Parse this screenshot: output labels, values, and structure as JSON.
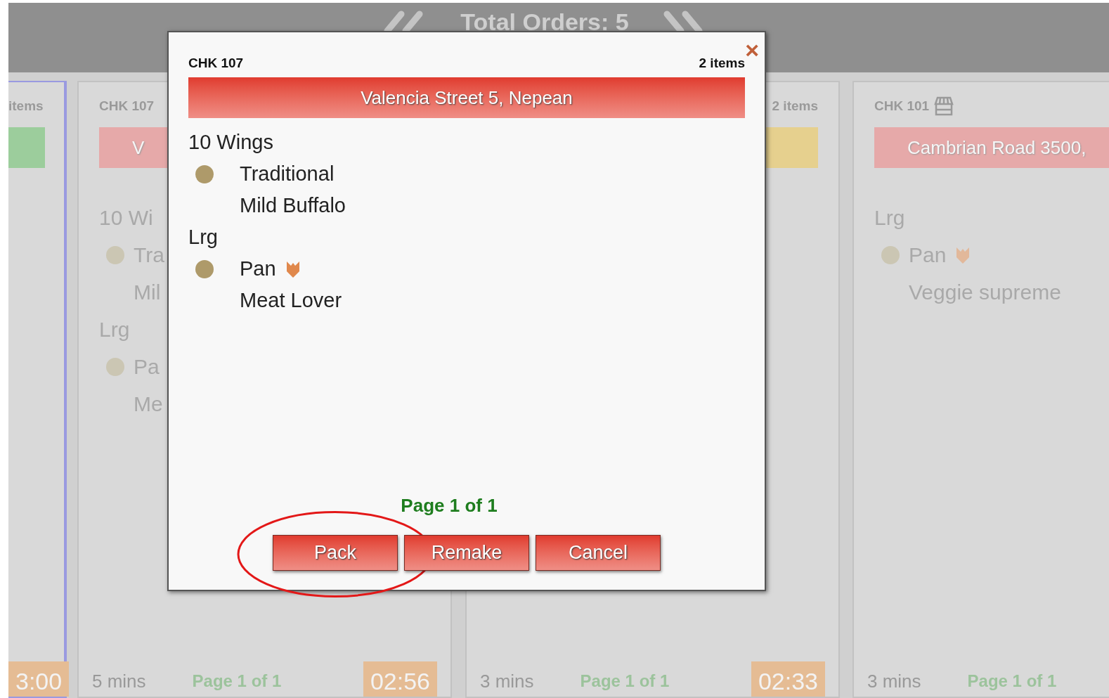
{
  "header": {
    "title": "Total Orders: 5"
  },
  "cards": [
    {
      "selected": true,
      "count": "items",
      "color": "#9ccd9c",
      "footer": {
        "timer": "3:00"
      }
    },
    {
      "selected": false,
      "check": "CHK 107",
      "address": "V",
      "color": "#e6a9a9",
      "lines": [
        {
          "kind": "group",
          "text": "10 Wi"
        },
        {
          "kind": "item",
          "text": "Tra"
        },
        {
          "kind": "sub",
          "text": "Mil"
        },
        {
          "kind": "group",
          "text": "Lrg"
        },
        {
          "kind": "item",
          "text": "Pa"
        },
        {
          "kind": "sub",
          "text": "Me"
        }
      ],
      "footer": {
        "duration": "5 mins",
        "page": "Page 1 of 1",
        "timer": "02:56"
      }
    },
    {
      "selected": false,
      "count": "2 items",
      "color": "#e6d08e",
      "footer": {
        "duration": "3 mins",
        "page": "Page 1 of 1",
        "timer": "02:33"
      }
    },
    {
      "selected": false,
      "check": "CHK 101",
      "store": true,
      "address": "Cambrian Road 3500,",
      "color": "#e6a9a9",
      "lines": [
        {
          "kind": "group",
          "text": "Lrg",
          "marked": false
        },
        {
          "kind": "item",
          "text": "Pan",
          "marked": true
        },
        {
          "kind": "sub",
          "text": "Veggie supreme",
          "marked": false
        }
      ],
      "footer": {
        "duration": "3 mins",
        "page": "Page 1 of 1"
      }
    }
  ],
  "modal": {
    "check": "CHK 107",
    "count": "2 items",
    "close": "×",
    "address": "Valencia Street 5, Nepean",
    "lines": [
      {
        "kind": "group",
        "text": "10 Wings",
        "marked": false
      },
      {
        "kind": "item",
        "text": "Traditional",
        "marked": false
      },
      {
        "kind": "sub",
        "text": "Mild Buffalo",
        "marked": false
      },
      {
        "kind": "group",
        "text": "Lrg",
        "marked": false
      },
      {
        "kind": "item",
        "text": "Pan",
        "marked": true
      },
      {
        "kind": "sub",
        "text": "Meat Lover",
        "marked": false
      }
    ],
    "page": "Page 1 of 1",
    "buttons": [
      {
        "label": "Pack",
        "highlighted": true
      },
      {
        "label": "Remake",
        "highlighted": false
      },
      {
        "label": "Cancel",
        "highlighted": false
      }
    ]
  }
}
